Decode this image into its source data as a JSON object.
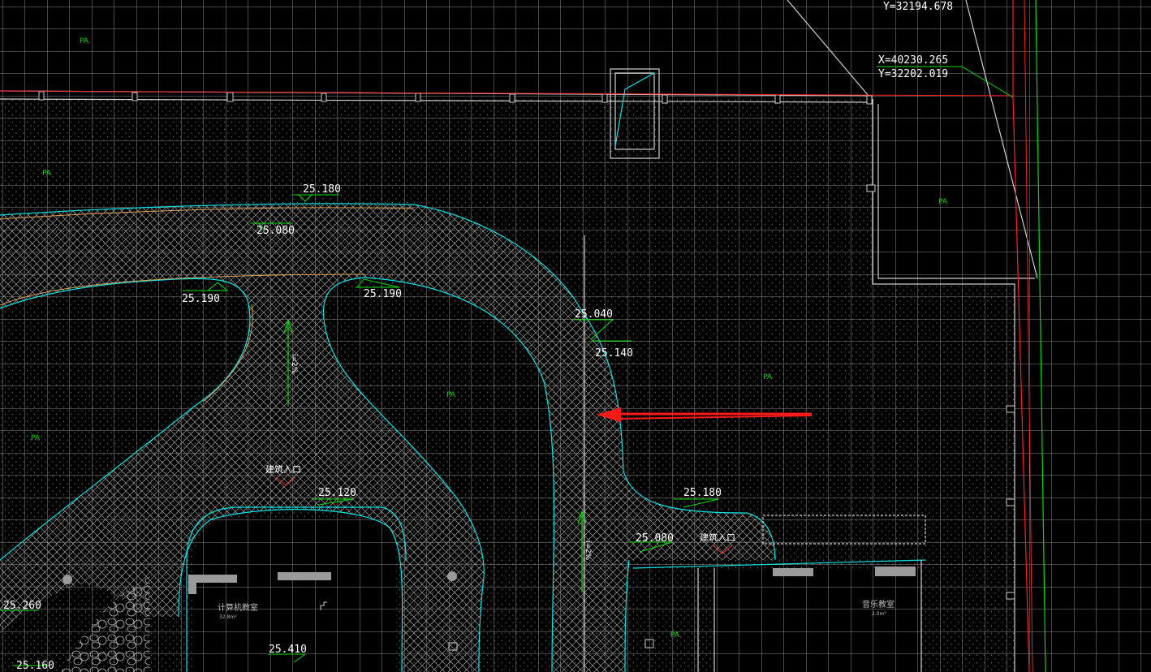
{
  "colors": {
    "background": "#000000",
    "grid": "#8a8a8a",
    "outline": "#d0d0d0",
    "cyan": "#00e5e5",
    "orange": "#d9a05a",
    "green": "#00dd00",
    "red_line": "#ff2020",
    "arrow": "#ff1a1a",
    "paving_dots": "#6a6a6a",
    "hatch": "#9a9a9a"
  },
  "coordinates": [
    {
      "text": "Y=32194.678"
    },
    {
      "text": "X=40230.265"
    },
    {
      "text": "Y=32202.019"
    }
  ],
  "elevations": [
    {
      "text": "25.180"
    },
    {
      "text": "25.080"
    },
    {
      "text": "25.190"
    },
    {
      "text": "25.190"
    },
    {
      "text": "25.040"
    },
    {
      "text": "25.140"
    },
    {
      "text": "25.120"
    },
    {
      "text": "25.180"
    },
    {
      "text": "25.080"
    },
    {
      "text": "25.260"
    },
    {
      "text": "25.410"
    },
    {
      "text": "25.160"
    }
  ],
  "pa_labels": [
    "PA",
    "PA",
    "PA",
    "PA",
    "PA",
    "PA",
    "PA"
  ],
  "entrances": [
    "建筑入口",
    "建筑入口"
  ],
  "rooms": {
    "computer_room": "计算机教室",
    "computer_room_sub": "32.8m²",
    "music_room": "音乐教室",
    "music_room_sub": "2.0m²"
  },
  "slopes": [
    "i=2%",
    "i=2%"
  ]
}
